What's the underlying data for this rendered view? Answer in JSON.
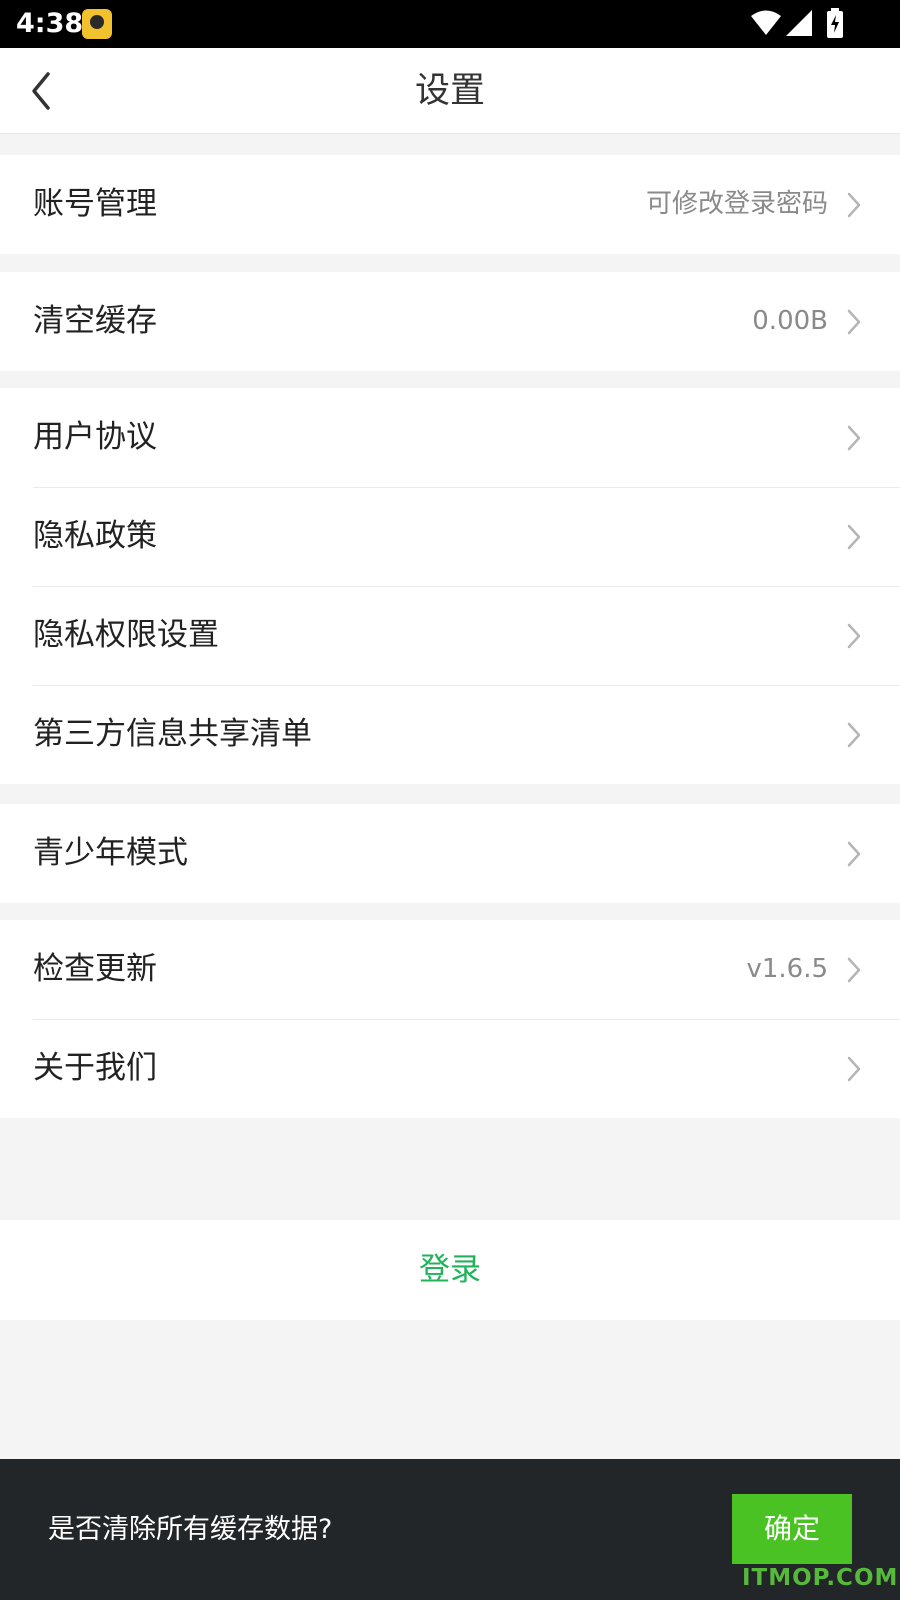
{
  "status_bar": {
    "time": "4:38"
  },
  "header": {
    "title": "设置"
  },
  "groups": [
    {
      "rows": [
        {
          "label": "账号管理",
          "value": "可修改登录密码"
        }
      ]
    },
    {
      "rows": [
        {
          "label": "清空缓存",
          "value": "0.00B"
        }
      ]
    },
    {
      "rows": [
        {
          "label": "用户协议",
          "value": ""
        },
        {
          "label": "隐私政策",
          "value": ""
        },
        {
          "label": "隐私权限设置",
          "value": ""
        },
        {
          "label": "第三方信息共享清单",
          "value": ""
        }
      ]
    },
    {
      "rows": [
        {
          "label": "青少年模式",
          "value": ""
        }
      ]
    },
    {
      "rows": [
        {
          "label": "检查更新",
          "value": "v1.6.5"
        },
        {
          "label": "关于我们",
          "value": ""
        }
      ]
    }
  ],
  "login": {
    "label": "登录"
  },
  "snackbar": {
    "message": "是否清除所有缓存数据?",
    "confirm_label": "确定"
  },
  "watermark": "ITMOP.COM",
  "colors": {
    "accent_green": "#21b25a",
    "snackbar_button": "#4ac224",
    "snackbar_bg": "#222629"
  },
  "icons": {
    "back": "chevron-left-icon",
    "row_arrow": "chevron-right-icon"
  }
}
